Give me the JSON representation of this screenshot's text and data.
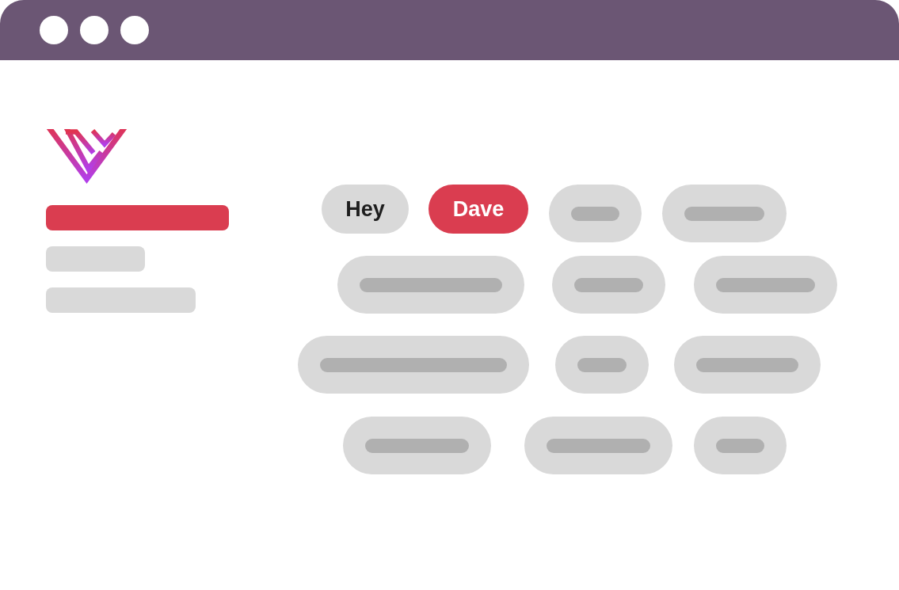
{
  "window": {
    "controls": [
      {
        "kind": "dot"
      },
      {
        "kind": "dot"
      },
      {
        "kind": "dot"
      }
    ]
  },
  "sidebar": {
    "items": [
      {
        "selected": true
      },
      {
        "selected": false
      },
      {
        "selected": false
      }
    ]
  },
  "chip_rows": [
    {
      "chips": [
        {
          "kind": "text",
          "label": "Hey",
          "selected": false
        },
        {
          "kind": "text",
          "label": "Dave",
          "selected": true
        },
        {
          "kind": "placeholder",
          "selected": false
        },
        {
          "kind": "placeholder",
          "selected": false
        }
      ]
    },
    {
      "chips": [
        {
          "kind": "placeholder",
          "selected": false
        },
        {
          "kind": "placeholder",
          "selected": false
        },
        {
          "kind": "placeholder",
          "selected": false
        }
      ]
    },
    {
      "chips": [
        {
          "kind": "placeholder",
          "selected": false
        },
        {
          "kind": "placeholder",
          "selected": false
        },
        {
          "kind": "placeholder",
          "selected": false
        }
      ]
    },
    {
      "chips": [
        {
          "kind": "placeholder",
          "selected": false
        },
        {
          "kind": "placeholder",
          "selected": false
        },
        {
          "kind": "placeholder",
          "selected": false
        }
      ]
    }
  ]
}
